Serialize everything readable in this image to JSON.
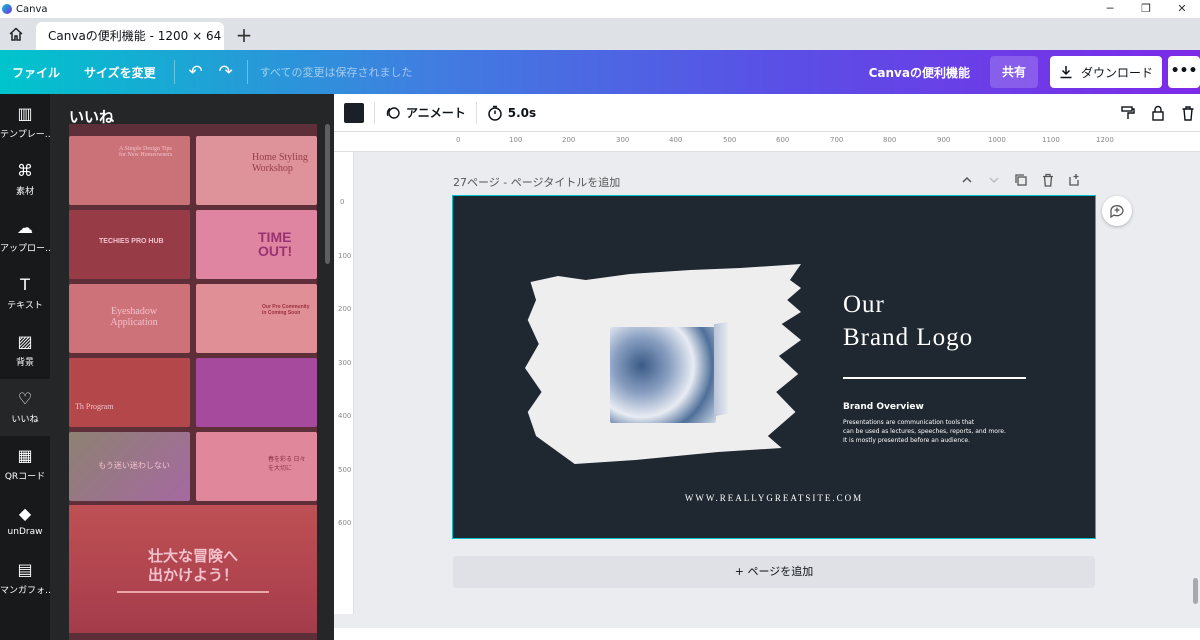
{
  "window": {
    "app_name": "Canva",
    "minimize": "─",
    "maximize": "❐",
    "close": "✕"
  },
  "tabs": {
    "home_icon": "home-icon",
    "active_tab": "Canvaの便利機能 - 1200 × 64",
    "add": "+"
  },
  "topbar": {
    "file": "ファイル",
    "resize": "サイズを変更",
    "undo": "↶",
    "redo": "↷",
    "save_status": "すべての変更は保存されました",
    "design_name": "Canvaの便利機能",
    "share": "共有",
    "download": "ダウンロード",
    "more": "•••",
    "colors": {
      "gradient_start": "#00c4cc",
      "gradient_end": "#7d2ae8"
    }
  },
  "rail": {
    "items": [
      {
        "label": "テンプレー…",
        "icon": "template-icon",
        "glyph": "▥"
      },
      {
        "label": "素材",
        "icon": "elements-icon",
        "glyph": "⌘"
      },
      {
        "label": "アップロー…",
        "icon": "upload-icon",
        "glyph": "☁"
      },
      {
        "label": "テキスト",
        "icon": "text-icon",
        "glyph": "T"
      },
      {
        "label": "背景",
        "icon": "background-icon",
        "glyph": "▨"
      },
      {
        "label": "いいね",
        "icon": "heart-icon",
        "glyph": "♡"
      },
      {
        "label": "QRコード",
        "icon": "qr-code-icon",
        "glyph": "▦"
      },
      {
        "label": "unDraw",
        "icon": "undraw-icon",
        "glyph": "◆"
      },
      {
        "label": "マンガフォ…",
        "icon": "manga-font-icon",
        "glyph": "▤"
      }
    ]
  },
  "panel": {
    "title": "いいね",
    "thumbnails": [
      {
        "text": "A Simple Design Tips for New Homeowners"
      },
      {
        "text": "Home Styling Workshop"
      },
      {
        "text": "TECHIES PRO HUB"
      },
      {
        "text": "TIME OUT!"
      },
      {
        "text": "Eyeshadow Application"
      },
      {
        "text": "Our Pro Community in Coming Soon"
      },
      {
        "text": "Th Program"
      },
      {
        "text": ""
      },
      {
        "text": "もう迷い迷わしない"
      },
      {
        "text": "春を彩る 日々を大切に"
      }
    ],
    "big_thumb": {
      "title_line1": "壮大な冒険へ",
      "title_line2": "出かけよう！"
    }
  },
  "editor_toolbar": {
    "animate": "アニメート",
    "duration": "5.0s",
    "icons": [
      "paint-roller-icon",
      "lock-icon",
      "trash-icon"
    ]
  },
  "ruler": {
    "top": [
      "0",
      "100",
      "200",
      "300",
      "400",
      "500",
      "600",
      "700",
      "800",
      "900",
      "1000",
      "1100",
      "1200"
    ],
    "left": [
      "0",
      "100",
      "200",
      "300",
      "400",
      "500",
      "600"
    ]
  },
  "page": {
    "title": "27ページ - ページタイトルを追加",
    "actions": [
      "chevron-up-icon",
      "chevron-down-icon",
      "duplicate-icon",
      "trash-icon",
      "add-page-icon"
    ]
  },
  "canvas": {
    "heading_line1": "Our",
    "heading_line2": "Brand Logo",
    "overview_title": "Brand Overview",
    "body_line1": "Presentations are communication tools that",
    "body_line2": "can be used as  lectures, speeches, reports, and more.",
    "body_line3": "It is mostly presented before an audience.",
    "website": "WWW.REALLYGREATSITE.COM",
    "colors": {
      "background": "#1f2730",
      "selection": "#00c4cc"
    }
  },
  "add_page": "+ ページを追加"
}
